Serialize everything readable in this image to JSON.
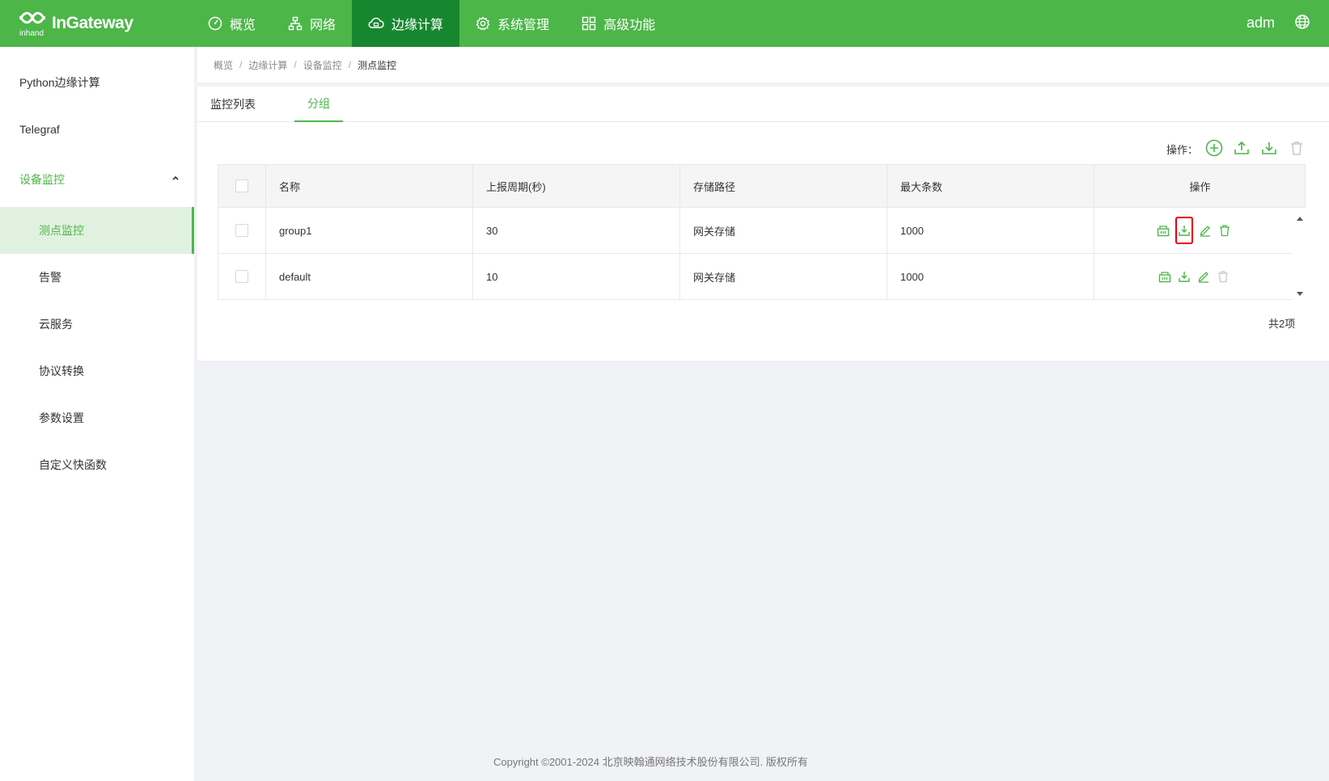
{
  "header": {
    "logo_text": "InGateway",
    "logo_sub": "inhand",
    "nav": [
      {
        "label": "概览",
        "icon": "dashboard-icon"
      },
      {
        "label": "网络",
        "icon": "network-icon"
      },
      {
        "label": "边缘计算",
        "icon": "cloud-icon",
        "active": true
      },
      {
        "label": "系统管理",
        "icon": "gear-icon"
      },
      {
        "label": "高级功能",
        "icon": "grid-icon"
      }
    ],
    "user": "adm"
  },
  "sidebar": {
    "items": [
      {
        "label": "Python边缘计算"
      },
      {
        "label": "Telegraf"
      },
      {
        "label": "设备监控",
        "expanded": true
      },
      {
        "label": "测点监控",
        "selected": true
      },
      {
        "label": "告警"
      },
      {
        "label": "云服务"
      },
      {
        "label": "协议转换"
      },
      {
        "label": "参数设置"
      },
      {
        "label": "自定义快函数"
      }
    ]
  },
  "breadcrumb": [
    "概览",
    "边缘计算",
    "设备监控",
    "测点监控"
  ],
  "tabs": [
    "监控列表",
    "分组"
  ],
  "toolbar": {
    "label": "操作："
  },
  "table": {
    "headers": [
      "名称",
      "上报周期(秒)",
      "存储路径",
      "最大条数",
      "操作"
    ],
    "rows": [
      {
        "name": "group1",
        "period": "30",
        "storage": "网关存储",
        "max": "1000"
      },
      {
        "name": "default",
        "period": "10",
        "storage": "网关存储",
        "max": "1000"
      }
    ],
    "total": "共2项"
  },
  "footer": "Copyright ©2001-2024 北京映翰通网络技术股份有限公司. 版权所有",
  "colors": {
    "brand": "#4cb648",
    "brand_dark": "#17872f",
    "highlight": "#e60012"
  }
}
